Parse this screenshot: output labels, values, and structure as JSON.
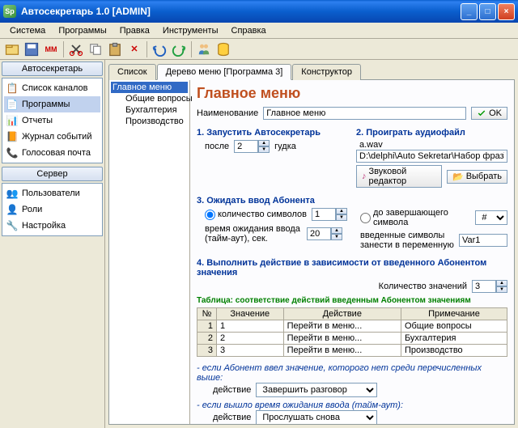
{
  "title": "Автосекретарь 1.0 [ADMIN]",
  "menubar": [
    "Система",
    "Программы",
    "Правка",
    "Инструменты",
    "Справка"
  ],
  "sidebar": {
    "panel1": {
      "title": "Автосекретарь",
      "items": [
        "Список каналов",
        "Программы",
        "Отчеты",
        "Журнал событий",
        "Голосовая почта"
      ],
      "selected": 1
    },
    "panel2": {
      "title": "Сервер",
      "items": [
        "Пользователи",
        "Роли",
        "Настройка"
      ]
    }
  },
  "tabs": [
    "Список",
    "Дерево меню [Программа 3]",
    "Конструктор"
  ],
  "active_tab": 1,
  "tree": {
    "root": "Главное меню",
    "children": [
      "Общие вопросы",
      "Бухгалтерия",
      "Производство"
    ]
  },
  "form": {
    "title": "Главное меню",
    "name_label": "Наименование",
    "name_value": "Главное меню",
    "ok": "OK",
    "sec1": {
      "title": "1. Запустить Автосекретарь",
      "after": "после",
      "beeps_value": "2",
      "beep": "гудка"
    },
    "sec2": {
      "title": "2. Проиграть аудиофайл",
      "file_short": "a.wav",
      "file_path": "D:\\delphi\\Auto Sekretar\\Набор фраз\\a.wav",
      "editor_btn": "Звуковой редактор",
      "browse_btn": "Выбрать"
    },
    "sec3": {
      "title": "3. Ожидать ввод Абонента",
      "opt1": "количество символов",
      "sym_value": "1",
      "timeout_label": "время ожидания ввода (тайм-аут), сек.",
      "timeout_value": "20",
      "opt2": "до завершающего символа",
      "term_value": "#",
      "saved_label": "введенные символы занести в переменную",
      "var_value": "Var1"
    },
    "sec4": {
      "title": "4. Выполнить действие в зависимости от введенного Абонентом значения",
      "count_label": "Количество значений",
      "count_value": "3",
      "table_caption": "Таблица: соответствие действий введенным Абонентом значениям",
      "headers": [
        "№",
        "Значение",
        "Действие",
        "Примечание"
      ],
      "rows": [
        {
          "n": "1",
          "val": "1",
          "act": "Перейти в меню...",
          "note": "Общие вопросы"
        },
        {
          "n": "2",
          "val": "2",
          "act": "Перейти в меню...",
          "note": "Бухгалтерия"
        },
        {
          "n": "3",
          "val": "3",
          "act": "Перейти в меню...",
          "note": "Производство"
        }
      ]
    },
    "fallback1_label": "- если Абонент ввел значение, которого нет среди перечисленных выше:",
    "fallback_action_label": "действие",
    "fallback1_value": "Завершить разговор",
    "fallback2_label": "- если вышло время ожидания ввода (тайм-аут):",
    "fallback2_value": "Прослушать снова"
  }
}
